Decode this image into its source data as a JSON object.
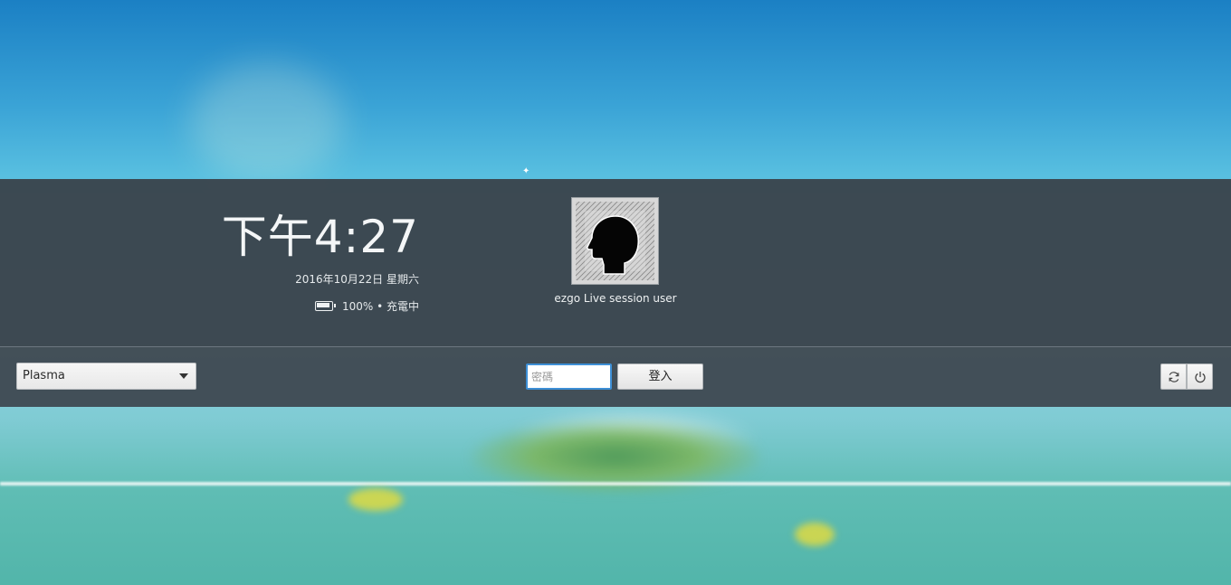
{
  "clock": {
    "time": "下午4:27",
    "date": "2016年10月22日 星期六",
    "battery_status": "100% • 充電中",
    "battery_level": 1.0
  },
  "user": {
    "name": "ezgo Live session user",
    "avatar_icon": "user-head-silhouette-icon"
  },
  "session": {
    "selected": "Plasma"
  },
  "login": {
    "password_placeholder": "密碼",
    "password_value": "",
    "submit_label": "登入"
  },
  "system_actions": {
    "restart_icon": "restart-icon",
    "shutdown_icon": "power-icon"
  },
  "colors": {
    "accent": "#3d8fd6",
    "panel": "#3a444c"
  }
}
